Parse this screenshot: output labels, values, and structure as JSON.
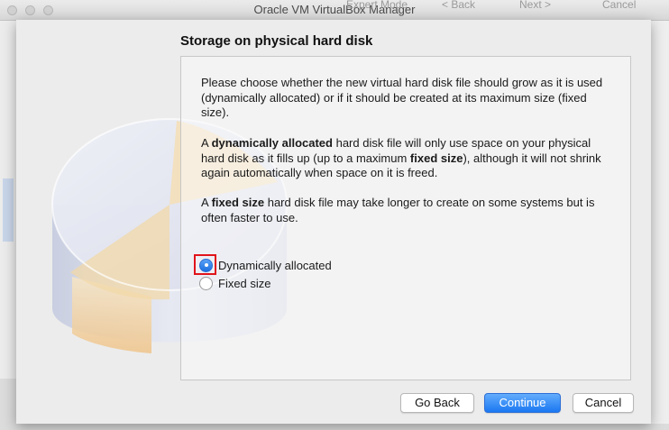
{
  "window": {
    "title": "Oracle VM VirtualBox Manager"
  },
  "background_ghost": {
    "expert_mode": "Expert Mode",
    "back": "< Back",
    "next": "Next >",
    "cancel": "Cancel"
  },
  "dialog": {
    "heading": "Storage on physical hard disk",
    "para1": "Please choose whether the new virtual hard disk file should grow as it is used (dynamically allocated) or if it should be created at its maximum size (fixed size).",
    "para2": {
      "a": "A ",
      "b1": "dynamically allocated",
      "c": " hard disk file will only use space on your physical hard disk as it fills up (up to a maximum ",
      "b2": "fixed size",
      "d": "), although it will not shrink again automatically when space on it is freed."
    },
    "para3": {
      "a": "A ",
      "b1": "fixed size",
      "c": " hard disk file may take longer to create on some systems but is often faster to use."
    },
    "options": [
      {
        "label": "Dynamically allocated",
        "selected": true
      },
      {
        "label": "Fixed size",
        "selected": false
      }
    ],
    "buttons": {
      "back": "Go Back",
      "continue": "Continue",
      "cancel": "Cancel"
    }
  },
  "colors": {
    "accent": "#1b78f2",
    "highlight": "#e0141b"
  }
}
